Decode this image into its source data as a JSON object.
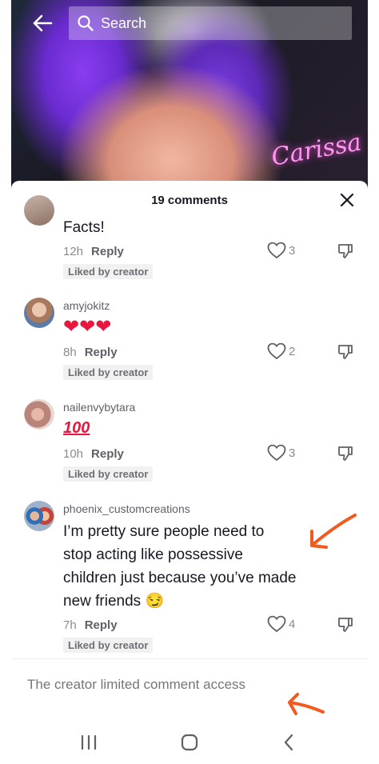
{
  "header": {
    "back_icon": "arrow-left-icon",
    "search_placeholder": "Search",
    "search_icon": "search-icon",
    "video_overlay_text": "Carissa"
  },
  "comments_panel": {
    "title": "19 comments",
    "close_icon": "close-icon",
    "comments": [
      {
        "username": "",
        "text": "Facts!",
        "time": "12h",
        "reply_label": "Reply",
        "liked_badge": "Liked by creator",
        "like_count": "3"
      },
      {
        "username": "amyjokitz",
        "text": "❤❤❤",
        "time": "8h",
        "reply_label": "Reply",
        "liked_badge": "Liked by creator",
        "like_count": "2"
      },
      {
        "username": "nailenvybytara",
        "text": "100",
        "time": "10h",
        "reply_label": "Reply",
        "liked_badge": "Liked by creator",
        "like_count": "3"
      },
      {
        "username": "phoenix_customcreations",
        "text_lines": [
          "I’m pretty sure people need to",
          "stop acting like possessive",
          "children just because you’ve made",
          "new friends 😏"
        ],
        "time": "7h",
        "reply_label": "Reply",
        "liked_badge": "Liked by creator",
        "like_count": "4"
      }
    ],
    "footer_notice": "The creator limited comment access"
  },
  "colors": {
    "annotation": "#f25a1f",
    "heart_red": "#e8173e",
    "text_primary": "#161823",
    "text_secondary": "#8a8b91"
  },
  "navbar": {
    "recent_icon": "recent-apps-icon",
    "home_icon": "home-icon",
    "back_icon": "back-chevron-icon"
  }
}
